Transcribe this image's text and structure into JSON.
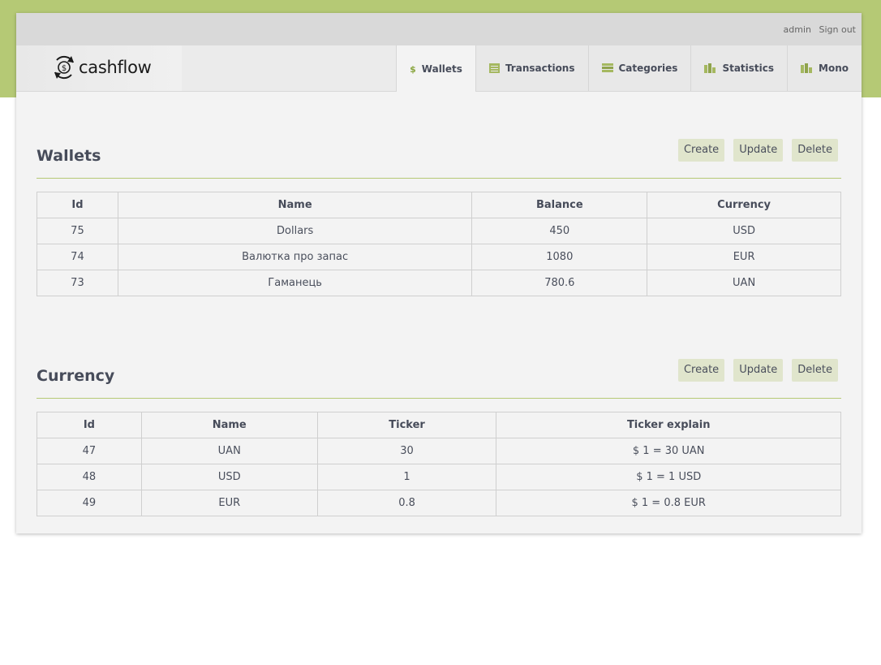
{
  "header": {
    "user": "admin",
    "sign_out": "Sign out",
    "logo_text": "cashflow"
  },
  "nav": {
    "tabs": [
      {
        "label": "Wallets",
        "icon": "dollar-icon",
        "active": true
      },
      {
        "label": "Transactions",
        "icon": "list-icon",
        "active": false
      },
      {
        "label": "Categories",
        "icon": "stack-icon",
        "active": false
      },
      {
        "label": "Statistics",
        "icon": "bar-chart-icon",
        "active": false
      },
      {
        "label": "Mono",
        "icon": "bar-chart-icon",
        "active": false
      }
    ]
  },
  "wallets": {
    "title": "Wallets",
    "buttons": {
      "create": "Create",
      "update": "Update",
      "delete": "Delete"
    },
    "columns": [
      "Id",
      "Name",
      "Balance",
      "Currency"
    ],
    "rows": [
      [
        "75",
        "Dollars",
        "450",
        "USD"
      ],
      [
        "74",
        "Валютка про запас",
        "1080",
        "EUR"
      ],
      [
        "73",
        "Гаманець",
        "780.6",
        "UAN"
      ]
    ]
  },
  "currency": {
    "title": "Currency",
    "buttons": {
      "create": "Create",
      "update": "Update",
      "delete": "Delete"
    },
    "columns": [
      "Id",
      "Name",
      "Ticker",
      "Ticker explain"
    ],
    "rows": [
      [
        "47",
        "UAN",
        "30",
        "$ 1 = 30 UAN"
      ],
      [
        "48",
        "USD",
        "1",
        "$ 1 = 1 USD"
      ],
      [
        "49",
        "EUR",
        "0.8",
        "$ 1 = 0.8 EUR"
      ]
    ]
  },
  "colors": {
    "accent_green": "#b5c975",
    "button_bg": "#e0e5cc",
    "card_bg": "#f3f3f3"
  }
}
